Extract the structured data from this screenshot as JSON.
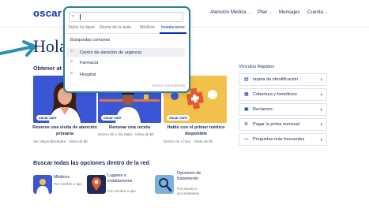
{
  "brand": {
    "logo": "oscar"
  },
  "nav": [
    {
      "label": "Atención Médica"
    },
    {
      "label": "Plan"
    },
    {
      "label": "Mensajes"
    },
    {
      "label": "Cuenta"
    }
  ],
  "greeting": "Hola",
  "obtener": {
    "title": "Obtener at"
  },
  "cards": [
    {
      "badge": "oscar care",
      "title": "Reserve una visita de atención primaria",
      "sub": "Ver disponibilidades · Visita de $0"
    },
    {
      "badge": "oscar care",
      "title": "Renovar una receta",
      "sub": "Dentro de 1 día hábil · Visita de $0"
    },
    {
      "badge": "oscar care",
      "title": "Hable con el primer médico disponible",
      "sub": "Dentro de 1 hora · Visita de $0"
    }
  ],
  "quick_links": {
    "title": "Vínculos Rápidos",
    "items": [
      {
        "label": "tarjeta de identificación",
        "icon": "id-card-icon"
      },
      {
        "label": "Cobertura y beneficios",
        "icon": "document-icon"
      },
      {
        "label": "Reclamos",
        "icon": "claims-icon"
      },
      {
        "label": "Pagar la prima mensual",
        "icon": "dollar-icon"
      },
      {
        "label": "Preguntas más frecuentes",
        "icon": "chat-icon"
      }
    ]
  },
  "network": {
    "title": "Buscar todas las opciones dentro de la red",
    "options": [
      {
        "title": "Médicos",
        "sub": "Por nombre o tipo"
      },
      {
        "title": "Lugares e instalaciones",
        "sub": "Por nombre o tipo"
      },
      {
        "title": "Opciones de tratamiento",
        "sub": "Por asunto o procedimiento"
      }
    ]
  },
  "search_overlay": {
    "tabs": [
      "Todos los tipos",
      "Razón de la visita",
      "Médicos",
      "Instalaciones"
    ],
    "active_tab": "Instalaciones",
    "common_title": "Búsquedas comunes",
    "suggestions": [
      "Centro de atención de urgencia",
      "Farmacia",
      "Hospital"
    ],
    "feedback": "Enviar comentarios"
  },
  "colors": {
    "brand_blue": "#0b2fb8",
    "overlay_border": "#2f7c9e",
    "arrow": "#2b90b8",
    "card_blue": "#3a56d6",
    "card_yellow": "#f2c14b"
  }
}
